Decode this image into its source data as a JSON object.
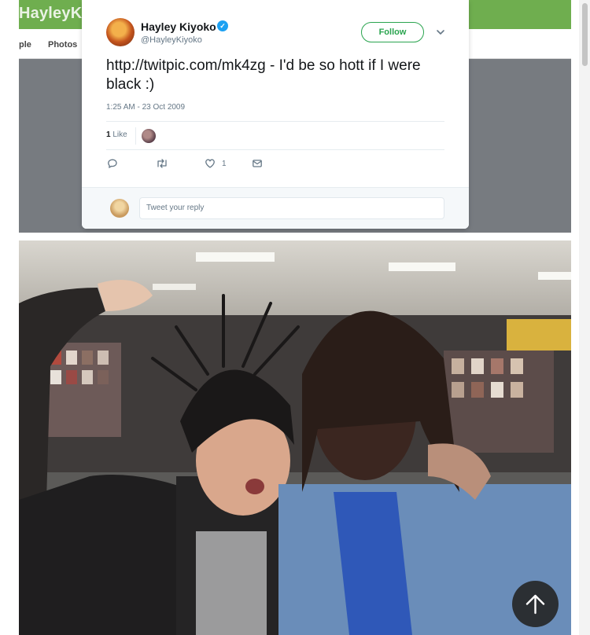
{
  "background_page": {
    "cover_name": "HayleyKiyoko",
    "nav_items": [
      "ple",
      "Photos"
    ]
  },
  "tweet": {
    "author_name": "Hayley Kiyoko",
    "author_handle": "@HayleyKiyoko",
    "follow_label": "Follow",
    "text": "http://twitpic.com/mk4zg - I'd be so hott if I were black :)",
    "timestamp": "1:25 AM - 23 Oct 2009",
    "likes_count": "1",
    "likes_label": "Like",
    "heart_count": "1",
    "reply_placeholder": "Tweet your reply"
  },
  "icons": [
    "verified-badge-icon",
    "chevron-down-icon",
    "reply-icon",
    "retweet-icon",
    "heart-icon",
    "direct-message-icon",
    "arrow-up-icon"
  ],
  "colors": {
    "cover_green": "#6fae4f",
    "follow_green": "#2aa44f",
    "verified_blue": "#1da1f2",
    "scroll_top_bg": "#2b2f33"
  }
}
